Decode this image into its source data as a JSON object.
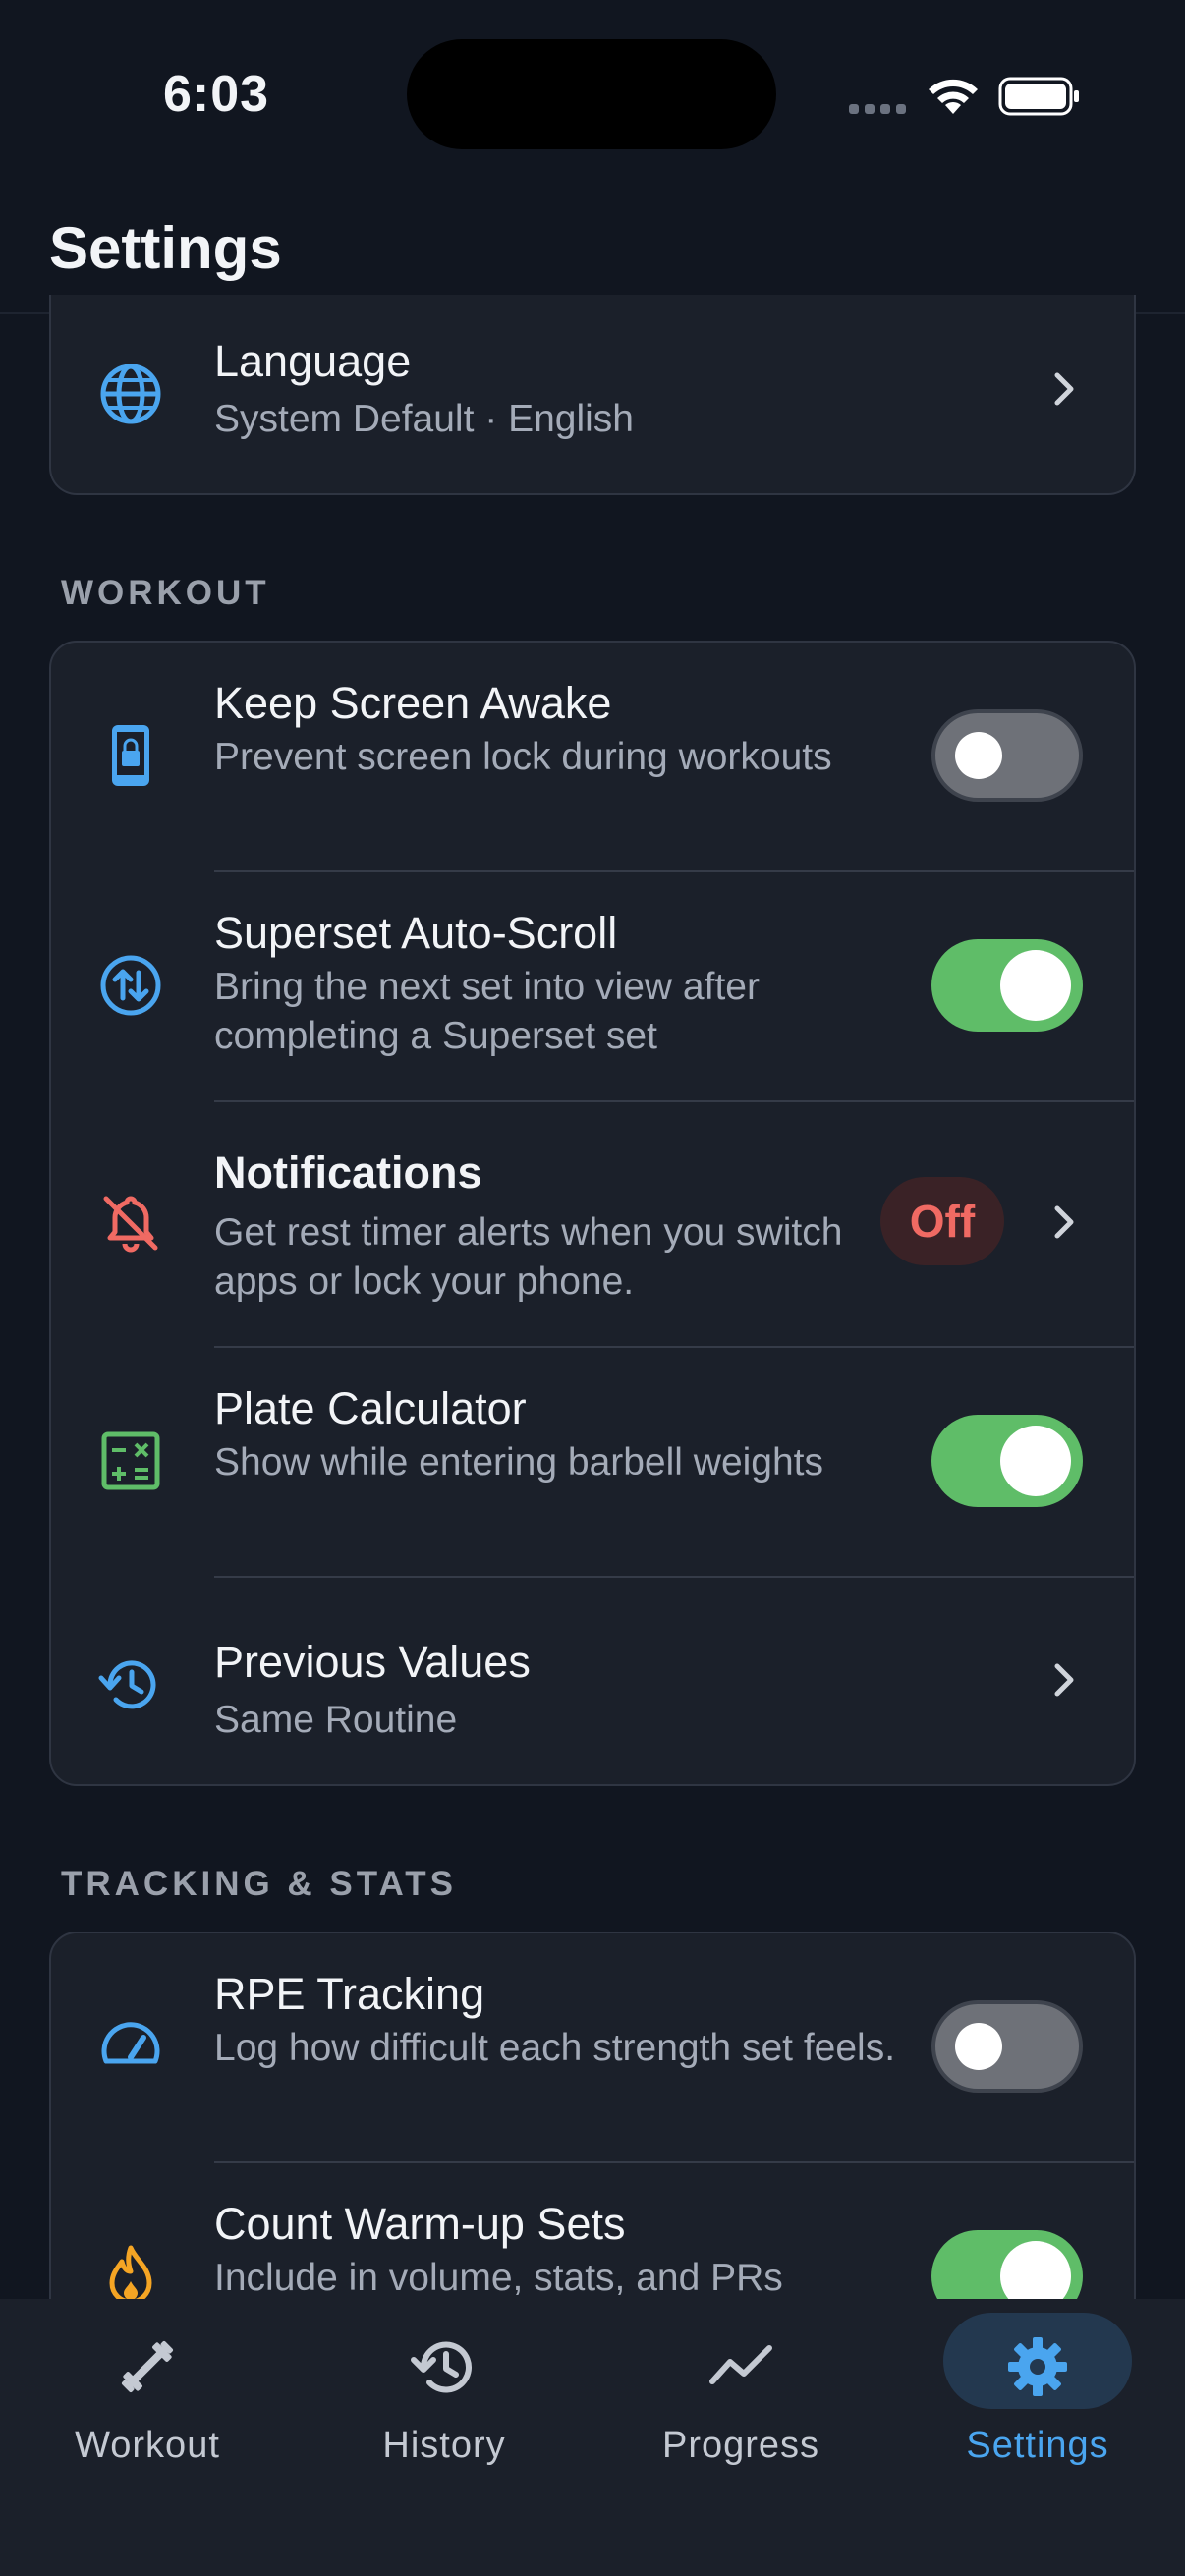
{
  "status": {
    "time": "6:03"
  },
  "header": {
    "title": "Settings"
  },
  "language": {
    "title": "Language",
    "subtitle": "System Default · English"
  },
  "sections": {
    "workout": "WORKOUT",
    "tracking": "TRACKING & STATS"
  },
  "workout": {
    "keep_awake": {
      "title": "Keep Screen Awake",
      "subtitle": "Prevent screen lock during workouts",
      "enabled": false
    },
    "superset": {
      "title": "Superset Auto-Scroll",
      "subtitle": "Bring the next set into view after completing a Superset set",
      "enabled": true
    },
    "notifications": {
      "title": "Notifications",
      "subtitle": "Get rest timer alerts when you switch apps or lock your phone.",
      "badge": "Off"
    },
    "plate_calc": {
      "title": "Plate Calculator",
      "subtitle": "Show while entering barbell weights",
      "enabled": true
    },
    "previous_values": {
      "title": "Previous Values",
      "subtitle": "Same Routine"
    }
  },
  "tracking": {
    "rpe": {
      "title": "RPE Tracking",
      "subtitle": "Log how difficult each strength set feels.",
      "enabled": false
    },
    "warmup": {
      "title": "Count Warm-up Sets",
      "subtitle": "Include in volume, stats, and PRs",
      "enabled": true
    }
  },
  "nav": {
    "workout": "Workout",
    "history": "History",
    "progress": "Progress",
    "settings": "Settings"
  },
  "colors": {
    "background": "#111620",
    "card": "#1b202a",
    "accent_blue": "#4aa5ef",
    "toggle_on": "#5fbd68",
    "alert_red": "#f06a63",
    "calc_green": "#5fbd68",
    "flame_orange": "#f5a524"
  }
}
